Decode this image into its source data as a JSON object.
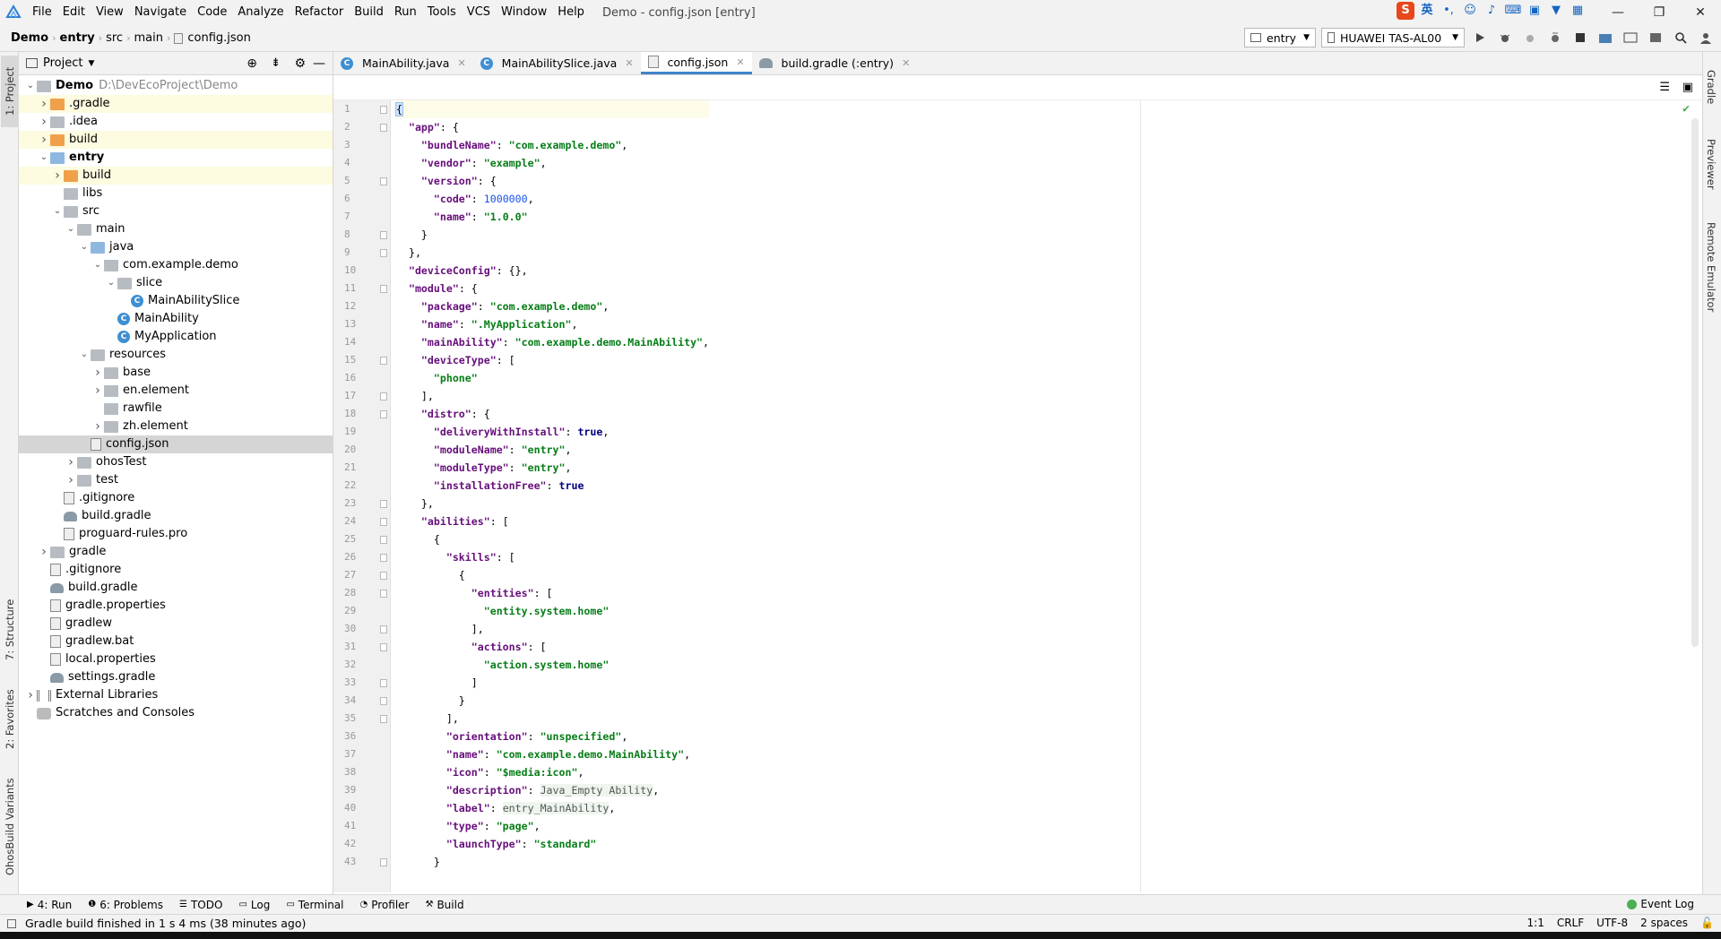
{
  "menubar": {
    "items": [
      "File",
      "Edit",
      "View",
      "Navigate",
      "Code",
      "Analyze",
      "Refactor",
      "Build",
      "Run",
      "Tools",
      "VCS",
      "Window",
      "Help"
    ],
    "window_title": "Demo - config.json [entry]",
    "ime_label": "英"
  },
  "navbar": {
    "crumbs": [
      "Demo",
      "entry",
      "src",
      "main",
      "config.json"
    ],
    "run_config": "entry",
    "device": "HUAWEI TAS-AL00"
  },
  "left_strip": {
    "project": "1: Project",
    "structure": "7: Structure",
    "favorites": "2: Favorites",
    "variants": "OhosBuild Variants"
  },
  "right_strip": {
    "gradle": "Gradle",
    "previewer": "Previewer",
    "emulator": "Remote Emulator"
  },
  "project_panel": {
    "title": "Project",
    "tree": [
      {
        "label": "Demo",
        "extra": "D:\\DevEcoProject\\Demo",
        "indent": 0,
        "arrow": "down",
        "icon": "folder",
        "bold": true
      },
      {
        "label": ".gradle",
        "indent": 1,
        "arrow": "right",
        "icon": "folder-orange",
        "hl": true
      },
      {
        "label": ".idea",
        "indent": 1,
        "arrow": "right",
        "icon": "folder"
      },
      {
        "label": "build",
        "indent": 1,
        "arrow": "right",
        "icon": "folder-orange",
        "hl": true
      },
      {
        "label": "entry",
        "indent": 1,
        "arrow": "down",
        "icon": "folder-blue",
        "bold": true
      },
      {
        "label": "build",
        "indent": 2,
        "arrow": "right",
        "icon": "folder-orange",
        "hl": true
      },
      {
        "label": "libs",
        "indent": 2,
        "arrow": "",
        "icon": "folder"
      },
      {
        "label": "src",
        "indent": 2,
        "arrow": "down",
        "icon": "folder"
      },
      {
        "label": "main",
        "indent": 3,
        "arrow": "down",
        "icon": "folder"
      },
      {
        "label": "java",
        "indent": 4,
        "arrow": "down",
        "icon": "folder-blue"
      },
      {
        "label": "com.example.demo",
        "indent": 5,
        "arrow": "down",
        "icon": "folder"
      },
      {
        "label": "slice",
        "indent": 6,
        "arrow": "down",
        "icon": "folder"
      },
      {
        "label": "MainAbilitySlice",
        "indent": 7,
        "arrow": "",
        "icon": "class"
      },
      {
        "label": "MainAbility",
        "indent": 6,
        "arrow": "",
        "icon": "class"
      },
      {
        "label": "MyApplication",
        "indent": 6,
        "arrow": "",
        "icon": "class"
      },
      {
        "label": "resources",
        "indent": 4,
        "arrow": "down",
        "icon": "folder"
      },
      {
        "label": "base",
        "indent": 5,
        "arrow": "right",
        "icon": "folder"
      },
      {
        "label": "en.element",
        "indent": 5,
        "arrow": "right",
        "icon": "folder"
      },
      {
        "label": "rawfile",
        "indent": 5,
        "arrow": "",
        "icon": "folder"
      },
      {
        "label": "zh.element",
        "indent": 5,
        "arrow": "right",
        "icon": "folder"
      },
      {
        "label": "config.json",
        "indent": 4,
        "arrow": "",
        "icon": "file",
        "sel": true
      },
      {
        "label": "ohosTest",
        "indent": 3,
        "arrow": "right",
        "icon": "folder"
      },
      {
        "label": "test",
        "indent": 3,
        "arrow": "right",
        "icon": "folder"
      },
      {
        "label": ".gitignore",
        "indent": 2,
        "arrow": "",
        "icon": "file"
      },
      {
        "label": "build.gradle",
        "indent": 2,
        "arrow": "",
        "icon": "gradle"
      },
      {
        "label": "proguard-rules.pro",
        "indent": 2,
        "arrow": "",
        "icon": "file"
      },
      {
        "label": "gradle",
        "indent": 1,
        "arrow": "right",
        "icon": "folder"
      },
      {
        "label": ".gitignore",
        "indent": 1,
        "arrow": "",
        "icon": "file"
      },
      {
        "label": "build.gradle",
        "indent": 1,
        "arrow": "",
        "icon": "gradle"
      },
      {
        "label": "gradle.properties",
        "indent": 1,
        "arrow": "",
        "icon": "file"
      },
      {
        "label": "gradlew",
        "indent": 1,
        "arrow": "",
        "icon": "file"
      },
      {
        "label": "gradlew.bat",
        "indent": 1,
        "arrow": "",
        "icon": "file"
      },
      {
        "label": "local.properties",
        "indent": 1,
        "arrow": "",
        "icon": "file"
      },
      {
        "label": "settings.gradle",
        "indent": 1,
        "arrow": "",
        "icon": "gradle"
      },
      {
        "label": "External Libraries",
        "indent": 0,
        "arrow": "right",
        "icon": "lib"
      },
      {
        "label": "Scratches and Consoles",
        "indent": 0,
        "arrow": "",
        "icon": "scratch"
      }
    ]
  },
  "editor": {
    "tabs": [
      {
        "label": "MainAbility.java",
        "icon": "class",
        "active": false
      },
      {
        "label": "MainAbilitySlice.java",
        "icon": "class",
        "active": false
      },
      {
        "label": "config.json",
        "icon": "file",
        "active": true
      },
      {
        "label": "build.gradle (:entry)",
        "icon": "gradle",
        "active": false
      }
    ],
    "lines": [
      [
        [
          "p",
          "{"
        ]
      ],
      [
        [
          "p",
          "  "
        ],
        [
          "k",
          "\"app\""
        ],
        [
          "p",
          ": {"
        ]
      ],
      [
        [
          "p",
          "    "
        ],
        [
          "k",
          "\"bundleName\""
        ],
        [
          "p",
          ": "
        ],
        [
          "s",
          "\"com.example.demo\""
        ],
        [
          "p",
          ","
        ]
      ],
      [
        [
          "p",
          "    "
        ],
        [
          "k",
          "\"vendor\""
        ],
        [
          "p",
          ": "
        ],
        [
          "s",
          "\"example\""
        ],
        [
          "p",
          ","
        ]
      ],
      [
        [
          "p",
          "    "
        ],
        [
          "k",
          "\"version\""
        ],
        [
          "p",
          ": {"
        ]
      ],
      [
        [
          "p",
          "      "
        ],
        [
          "k",
          "\"code\""
        ],
        [
          "p",
          ": "
        ],
        [
          "n",
          "1000000"
        ],
        [
          "p",
          ","
        ]
      ],
      [
        [
          "p",
          "      "
        ],
        [
          "k",
          "\"name\""
        ],
        [
          "p",
          ": "
        ],
        [
          "s",
          "\"1.0.0\""
        ]
      ],
      [
        [
          "p",
          "    }"
        ]
      ],
      [
        [
          "p",
          "  },"
        ]
      ],
      [
        [
          "p",
          "  "
        ],
        [
          "k",
          "\"deviceConfig\""
        ],
        [
          "p",
          ": {},"
        ]
      ],
      [
        [
          "p",
          "  "
        ],
        [
          "k",
          "\"module\""
        ],
        [
          "p",
          ": {"
        ]
      ],
      [
        [
          "p",
          "    "
        ],
        [
          "k",
          "\"package\""
        ],
        [
          "p",
          ": "
        ],
        [
          "s",
          "\"com.example.demo\""
        ],
        [
          "p",
          ","
        ]
      ],
      [
        [
          "p",
          "    "
        ],
        [
          "k",
          "\"name\""
        ],
        [
          "p",
          ": "
        ],
        [
          "s",
          "\".MyApplication\""
        ],
        [
          "p",
          ","
        ]
      ],
      [
        [
          "p",
          "    "
        ],
        [
          "k",
          "\"mainAbility\""
        ],
        [
          "p",
          ": "
        ],
        [
          "s",
          "\"com.example.demo.MainAbility\""
        ],
        [
          "p",
          ","
        ]
      ],
      [
        [
          "p",
          "    "
        ],
        [
          "k",
          "\"deviceType\""
        ],
        [
          "p",
          ": ["
        ]
      ],
      [
        [
          "p",
          "      "
        ],
        [
          "s",
          "\"phone\""
        ]
      ],
      [
        [
          "p",
          "    ],"
        ]
      ],
      [
        [
          "p",
          "    "
        ],
        [
          "k",
          "\"distro\""
        ],
        [
          "p",
          ": {"
        ]
      ],
      [
        [
          "p",
          "      "
        ],
        [
          "k",
          "\"deliveryWithInstall\""
        ],
        [
          "p",
          ": "
        ],
        [
          "kw",
          "true"
        ],
        [
          "p",
          ","
        ]
      ],
      [
        [
          "p",
          "      "
        ],
        [
          "k",
          "\"moduleName\""
        ],
        [
          "p",
          ": "
        ],
        [
          "s",
          "\"entry\""
        ],
        [
          "p",
          ","
        ]
      ],
      [
        [
          "p",
          "      "
        ],
        [
          "k",
          "\"moduleType\""
        ],
        [
          "p",
          ": "
        ],
        [
          "s",
          "\"entry\""
        ],
        [
          "p",
          ","
        ]
      ],
      [
        [
          "p",
          "      "
        ],
        [
          "k",
          "\"installationFree\""
        ],
        [
          "p",
          ": "
        ],
        [
          "kw",
          "true"
        ]
      ],
      [
        [
          "p",
          "    },"
        ]
      ],
      [
        [
          "p",
          "    "
        ],
        [
          "k",
          "\"abilities\""
        ],
        [
          "p",
          ": ["
        ]
      ],
      [
        [
          "p",
          "      {"
        ]
      ],
      [
        [
          "p",
          "        "
        ],
        [
          "k",
          "\"skills\""
        ],
        [
          "p",
          ": ["
        ]
      ],
      [
        [
          "p",
          "          {"
        ]
      ],
      [
        [
          "p",
          "            "
        ],
        [
          "k",
          "\"entities\""
        ],
        [
          "p",
          ": ["
        ]
      ],
      [
        [
          "p",
          "              "
        ],
        [
          "s",
          "\"entity.system.home\""
        ]
      ],
      [
        [
          "p",
          "            ],"
        ]
      ],
      [
        [
          "p",
          "            "
        ],
        [
          "k",
          "\"actions\""
        ],
        [
          "p",
          ": ["
        ]
      ],
      [
        [
          "p",
          "              "
        ],
        [
          "s",
          "\"action.system.home\""
        ]
      ],
      [
        [
          "p",
          "            ]"
        ]
      ],
      [
        [
          "p",
          "          }"
        ]
      ],
      [
        [
          "p",
          "        ],"
        ]
      ],
      [
        [
          "p",
          "        "
        ],
        [
          "k",
          "\"orientation\""
        ],
        [
          "p",
          ": "
        ],
        [
          "s",
          "\"unspecified\""
        ],
        [
          "p",
          ","
        ]
      ],
      [
        [
          "p",
          "        "
        ],
        [
          "k",
          "\"name\""
        ],
        [
          "p",
          ": "
        ],
        [
          "s",
          "\"com.example.demo.MainAbility\""
        ],
        [
          "p",
          ","
        ]
      ],
      [
        [
          "p",
          "        "
        ],
        [
          "k",
          "\"icon\""
        ],
        [
          "p",
          ": "
        ],
        [
          "s",
          "\"$media:icon\""
        ],
        [
          "p",
          ","
        ]
      ],
      [
        [
          "p",
          "        "
        ],
        [
          "k",
          "\"description\""
        ],
        [
          "p",
          ": "
        ],
        [
          "e",
          "Java_Empty Ability"
        ],
        [
          "p",
          ","
        ]
      ],
      [
        [
          "p",
          "        "
        ],
        [
          "k",
          "\"label\""
        ],
        [
          "p",
          ": "
        ],
        [
          "e",
          "entry_MainAbility"
        ],
        [
          "p",
          ","
        ]
      ],
      [
        [
          "p",
          "        "
        ],
        [
          "k",
          "\"type\""
        ],
        [
          "p",
          ": "
        ],
        [
          "s",
          "\"page\""
        ],
        [
          "p",
          ","
        ]
      ],
      [
        [
          "p",
          "        "
        ],
        [
          "k",
          "\"launchType\""
        ],
        [
          "p",
          ": "
        ],
        [
          "s",
          "\"standard\""
        ]
      ],
      [
        [
          "p",
          "      }"
        ]
      ]
    ],
    "fold_lines": [
      1,
      2,
      5,
      8,
      9,
      11,
      15,
      17,
      18,
      23,
      24,
      25,
      26,
      27,
      28,
      30,
      31,
      33,
      34,
      35,
      43
    ]
  },
  "bottom_tools": [
    "4: Run",
    "6: Problems",
    "TODO",
    "Log",
    "Terminal",
    "Profiler",
    "Build"
  ],
  "event_log": "Event Log",
  "status": {
    "message": "Gradle build finished in 1 s 4 ms (38 minutes ago)",
    "position": "1:1",
    "line_sep": "CRLF",
    "encoding": "UTF-8",
    "indent": "2 spaces"
  }
}
